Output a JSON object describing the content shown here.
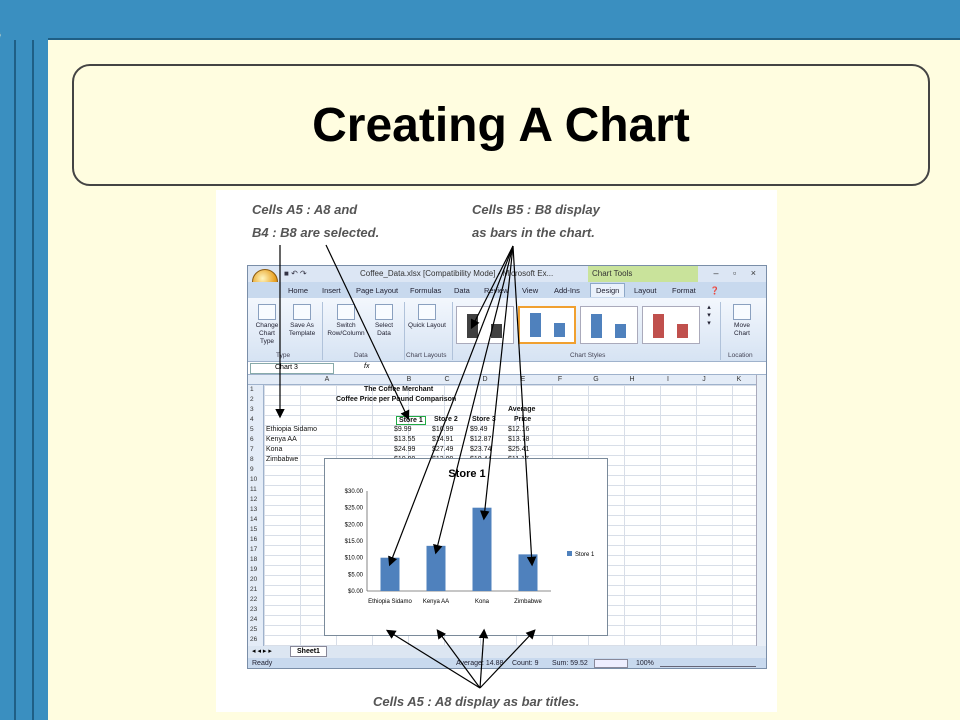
{
  "slide": {
    "title": "Creating A Chart"
  },
  "callouts": {
    "top_left_line1": "Cells A5 : A8 and",
    "top_left_line2": "B4 : B8 are selected.",
    "top_right_line1": "Cells B5 : B8 display",
    "top_right_line2": "as bars in the chart.",
    "bottom": "Cells A5 : A8 display as bar titles."
  },
  "excel": {
    "window_title": "Coffee_Data.xlsx  [Compatibility Mode] - Microsoft Ex...",
    "contextual_tab": "Chart Tools",
    "window_buttons": "–  ▫  ×",
    "tabs": [
      "Home",
      "Insert",
      "Page Layout",
      "Formulas",
      "Data",
      "Review",
      "View",
      "Add-Ins",
      "Design",
      "Layout",
      "Format"
    ],
    "active_tab": "Design",
    "ribbon": {
      "change_chart_type": "Change Chart Type",
      "save_as_template": "Save As Template",
      "switch_row_column": "Switch Row/Column",
      "select_data": "Select Data",
      "quick_layout": "Quick Layout",
      "move_chart": "Move Chart",
      "groups": [
        "Type",
        "Data",
        "Chart Layouts",
        "Chart Styles",
        "Location"
      ]
    },
    "name_box": "Chart 3",
    "fx_label": "fx",
    "columns": [
      "A",
      "B",
      "C",
      "D",
      "E",
      "F",
      "G",
      "H",
      "I",
      "J",
      "K"
    ],
    "rows": [
      "1",
      "2",
      "3",
      "4",
      "5",
      "6",
      "7",
      "8",
      "9",
      "10",
      "11",
      "12",
      "13",
      "14",
      "15",
      "16",
      "17",
      "18",
      "19",
      "20",
      "21",
      "22",
      "23",
      "24",
      "25",
      "26"
    ],
    "sheet": {
      "title1": "The Coffee Merchant",
      "title2": "Coffee Price per Pound Comparison",
      "avg_header1": "Average",
      "avg_header2": "Price",
      "headers": [
        "Store 1",
        "Store 2",
        "Store 3"
      ],
      "data": [
        [
          "Ethiopia Sidamo",
          "$9.99",
          "$16.99",
          "$9.49",
          "$12.16"
        ],
        [
          "Kenya AA",
          "$13.55",
          "$14.91",
          "$12.87",
          "$13.78"
        ],
        [
          "Kona",
          "$24.99",
          "$27.49",
          "$23.74",
          "$25.41"
        ],
        [
          "Zimbabwe",
          "$10.99",
          "$12.09",
          "$10.44",
          "$11.17"
        ]
      ]
    },
    "sheet_tab": "Sheet1",
    "status": {
      "ready": "Ready",
      "average": "Average: 14.88",
      "count": "Count: 9",
      "sum": "Sum: 59.52",
      "zoom": "100%"
    }
  },
  "chart_data": {
    "type": "bar",
    "title": "Store 1",
    "categories": [
      "Ethiopia Sidamo",
      "Kenya AA",
      "Kona",
      "Zimbabwe"
    ],
    "series": [
      {
        "name": "Store 1",
        "values": [
          9.99,
          13.55,
          24.99,
          10.99
        ],
        "color": "#4f81bd"
      }
    ],
    "ylim": [
      0,
      30
    ],
    "yticks": [
      "$0.00",
      "$5.00",
      "$10.00",
      "$15.00",
      "$20.00",
      "$25.00",
      "$30.00"
    ],
    "legend": "right"
  }
}
